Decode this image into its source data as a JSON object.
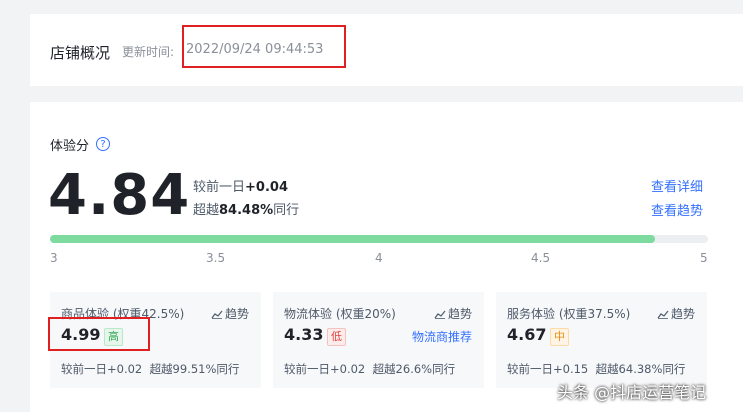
{
  "overview": {
    "title": "店铺概况",
    "update_label": "更新时间:",
    "update_time": "2022/09/24 09:44:53"
  },
  "experience": {
    "title": "体验分",
    "help_icon": "question-circle-icon",
    "score": "4.84",
    "compare_prefix": "较前一日",
    "compare_value": "+0.04",
    "beat_prefix": "超越",
    "beat_value": "84.48%",
    "beat_suffix": "同行",
    "link_detail": "查看详细",
    "link_trend": "查看趋势",
    "progress": {
      "min": 3,
      "max": 5,
      "value": 4.84,
      "color": "#7ddba0"
    },
    "ticks": [
      "3",
      "3.5",
      "4",
      "4.5",
      "5"
    ]
  },
  "subscores": [
    {
      "title": "商品体验 (权重42.5%)",
      "trend_label": "趋势",
      "score": "4.99",
      "badge": "高",
      "badge_level": "high",
      "foot_compare": "较前一日+0.02",
      "foot_beat": "超越99.51%同行"
    },
    {
      "title": "物流体验 (权重20%)",
      "trend_label": "趋势",
      "score": "4.33",
      "badge": "低",
      "badge_level": "low",
      "link": "物流商推荐",
      "foot_compare": "较前一日+0.02",
      "foot_beat": "超越26.6%同行"
    },
    {
      "title": "服务体验 (权重37.5%)",
      "trend_label": "趋势",
      "score": "4.67",
      "badge": "中",
      "badge_level": "mid",
      "foot_compare": "较前一日+0.15",
      "foot_beat": "超越64.38%同行"
    }
  ],
  "watermark": "头条 @抖店运营笔记",
  "colors": {
    "accent": "#3370ff",
    "highlight_box": "#e02020",
    "progress": "#7ddba0"
  }
}
